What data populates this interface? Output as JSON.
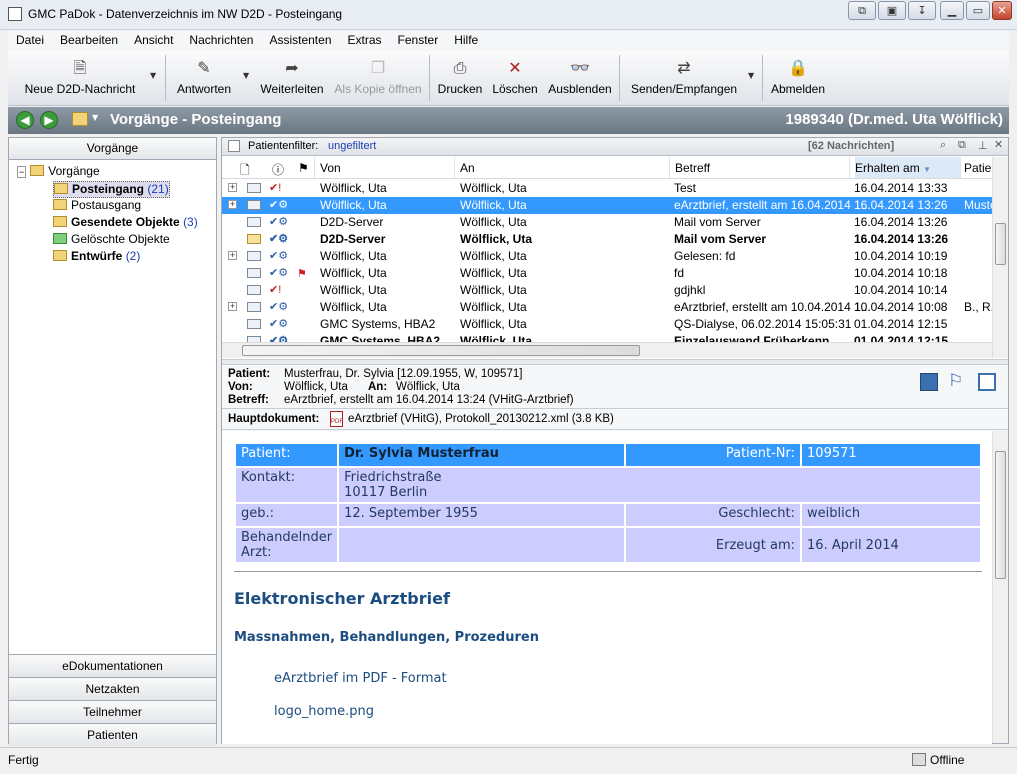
{
  "window": {
    "title": "GMC PaDok - Datenverzeichnis im NW D2D - Posteingang"
  },
  "menu": [
    "Datei",
    "Bearbeiten",
    "Ansicht",
    "Nachrichten",
    "Assistenten",
    "Extras",
    "Fenster",
    "Hilfe"
  ],
  "toolbar": {
    "new": "Neue D2D-Nachricht",
    "reply": "Antworten",
    "forward": "Weiterleiten",
    "copy": "Als Kopie öffnen",
    "print": "Drucken",
    "delete": "Löschen",
    "hide": "Ausblenden",
    "sendrecv": "Senden/Empfangen",
    "logout": "Abmelden"
  },
  "nav": {
    "title": "Vorgänge - Posteingang",
    "user": "1989340 (Dr.med. Uta Wölflick)"
  },
  "left": {
    "header": "Vorgänge",
    "root": "Vorgänge",
    "items": [
      {
        "label": "Posteingang",
        "count": "(21)"
      },
      {
        "label": "Postausgang",
        "count": ""
      },
      {
        "label": "Gesendete Objekte",
        "count": "(3)"
      },
      {
        "label": "Gelöschte Objekte",
        "count": ""
      },
      {
        "label": "Entwürfe",
        "count": "(2)"
      }
    ],
    "buttons": [
      "eDokumentationen",
      "Netzakten",
      "Teilnehmer",
      "Patienten"
    ]
  },
  "filter": {
    "label": "Patientenfilter:",
    "value": "ungefiltert",
    "count": "[62 Nachrichten]"
  },
  "columns": {
    "from": "Von",
    "to": "An",
    "subject": "Betreff",
    "received": "Erhalten am",
    "patient": "Patien"
  },
  "messages": [
    {
      "from": "Wölflick, Uta",
      "to": "Wölflick, Uta",
      "subject": "Test",
      "received": "16.04.2014 13:33",
      "patient": ""
    },
    {
      "from": "Wölflick, Uta",
      "to": "Wölflick, Uta",
      "subject": "eArztbrief, erstellt am 16.04.2014 1...",
      "received": "16.04.2014 13:26",
      "patient": "Muste"
    },
    {
      "from": "D2D-Server",
      "to": "Wölflick, Uta",
      "subject": "Mail vom Server",
      "received": "16.04.2014 13:26",
      "patient": ""
    },
    {
      "from": "D2D-Server",
      "to": "Wölflick, Uta",
      "subject": "Mail vom Server",
      "received": "16.04.2014 13:26",
      "patient": ""
    },
    {
      "from": "Wölflick, Uta",
      "to": "Wölflick, Uta",
      "subject": "Gelesen: fd",
      "received": "10.04.2014 10:19",
      "patient": ""
    },
    {
      "from": "Wölflick, Uta",
      "to": "Wölflick, Uta",
      "subject": "fd",
      "received": "10.04.2014 10:18",
      "patient": ""
    },
    {
      "from": "Wölflick, Uta",
      "to": "Wölflick, Uta",
      "subject": "gdjhkl",
      "received": "10.04.2014 10:14",
      "patient": ""
    },
    {
      "from": "Wölflick, Uta",
      "to": "Wölflick, Uta",
      "subject": "eArztbrief, erstellt am 10.04.2014 1...",
      "received": "10.04.2014 10:08",
      "patient": "B., R."
    },
    {
      "from": "GMC Systems, HBA2",
      "to": "Wölflick, Uta",
      "subject": "QS-Dialyse, 06.02.2014 15:05:31",
      "received": "01.04.2014 12:15",
      "patient": ""
    },
    {
      "from": "GMC Systems, HBA2",
      "to": "Wölflick, Uta",
      "subject": "Einzelauswand Früherkenn",
      "received": "01.04.2014 12:15",
      "patient": ""
    }
  ],
  "preview": {
    "patient_label": "Patient:",
    "patient": "Musterfrau, Dr. Sylvia   [12.09.1955, W, 109571]",
    "from_label": "Von:",
    "from": "Wölflick, Uta",
    "to_label": "An:",
    "to": "Wölflick, Uta",
    "subject_label": "Betreff:",
    "subject": "eArztbrief, erstellt am 16.04.2014 13:24  (VHitG-Arztbrief)",
    "main_label": "Hauptdokument:",
    "main_doc": "eArztbrief (VHitG),  Protokoll_20130212.xml (3.8 KB)"
  },
  "document": {
    "patient_label": "Patient:",
    "patient_name": "Dr. Sylvia Musterfrau",
    "patnr_label": "Patient-Nr:",
    "patnr": "109571",
    "contact_label": "Kontakt:",
    "street": "Friedrichstraße",
    "city": "10117 Berlin",
    "dob_label": "geb.:",
    "dob": "12. September 1955",
    "sex_label": "Geschlecht:",
    "sex": "weiblich",
    "doctor_label": "Behandelnder Arzt:",
    "created_label": "Erzeugt am:",
    "created": "16. April 2014",
    "h1": "Elektronischer Arztbrief",
    "h2": "Massnahmen, Behandlungen, Prozeduren",
    "link1": "eArztbrief im PDF - Format",
    "link2": "logo_home.png"
  },
  "status": {
    "left": "Fertig",
    "right": "Offline"
  }
}
